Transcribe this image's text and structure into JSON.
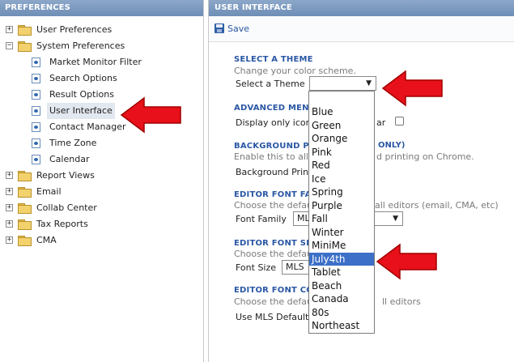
{
  "left_panel": {
    "title": "PREFERENCES",
    "tree": [
      {
        "label": "User Preferences",
        "type": "folder",
        "expander": "+"
      },
      {
        "label": "System Preferences",
        "type": "folder",
        "expander": "−"
      },
      {
        "label": "Market Monitor Filter",
        "type": "page"
      },
      {
        "label": "Search Options",
        "type": "page"
      },
      {
        "label": "Result Options",
        "type": "page"
      },
      {
        "label": "User Interface",
        "type": "page",
        "selected": true
      },
      {
        "label": "Contact Manager",
        "type": "page"
      },
      {
        "label": "Time Zone",
        "type": "page"
      },
      {
        "label": "Calendar",
        "type": "page"
      },
      {
        "label": "Report Views",
        "type": "folder",
        "expander": "+"
      },
      {
        "label": "Email",
        "type": "folder",
        "expander": "+"
      },
      {
        "label": "Collab Center",
        "type": "folder",
        "expander": "+"
      },
      {
        "label": "Tax Reports",
        "type": "folder",
        "expander": "+"
      },
      {
        "label": "CMA",
        "type": "folder",
        "expander": "+"
      }
    ]
  },
  "right_panel": {
    "title": "USER INTERFACE",
    "save_label": "Save",
    "sections": {
      "theme": {
        "title": "SELECT A THEME",
        "desc": "Change your color scheme.",
        "label": "Select a Theme",
        "value": "",
        "options": [
          "Blue",
          "Green",
          "Orange",
          "Pink",
          "Red",
          "Ice",
          "Spring",
          "Purple",
          "Fall",
          "Winter",
          "MiniMe",
          "July4th",
          "Tablet",
          "Beach",
          "Canada",
          "80s",
          "Northeast"
        ],
        "highlighted": "July4th"
      },
      "advanced_menu": {
        "title": "ADVANCED MENU",
        "label": "Display only icons",
        "right_text": "ar"
      },
      "background_print": {
        "title": "BACKGROUND P",
        "title_right": "ONLY)",
        "desc": "Enable this to allow",
        "desc_right": "d printing on Chrome.",
        "label": "Background Print"
      },
      "font_family": {
        "title": "EDITOR FONT FA",
        "desc": "Choose the default",
        "desc_right": "all editors (email, CMA, etc)",
        "label": "Font Family",
        "value": "ML"
      },
      "font_size": {
        "title": "EDITOR FONT SI",
        "desc": "Choose the defaul",
        "label": "Font Size",
        "value": "MLS"
      },
      "font_color": {
        "title": "EDITOR FONT CO",
        "desc": "Choose the defaul",
        "desc_right": "ll editors",
        "label": "Use MLS Default"
      }
    }
  },
  "colors": {
    "header_bg": "#7a97bf",
    "section_title": "#2a57a4",
    "highlight": "#3c6fc8",
    "arrow": "#e8101a"
  }
}
